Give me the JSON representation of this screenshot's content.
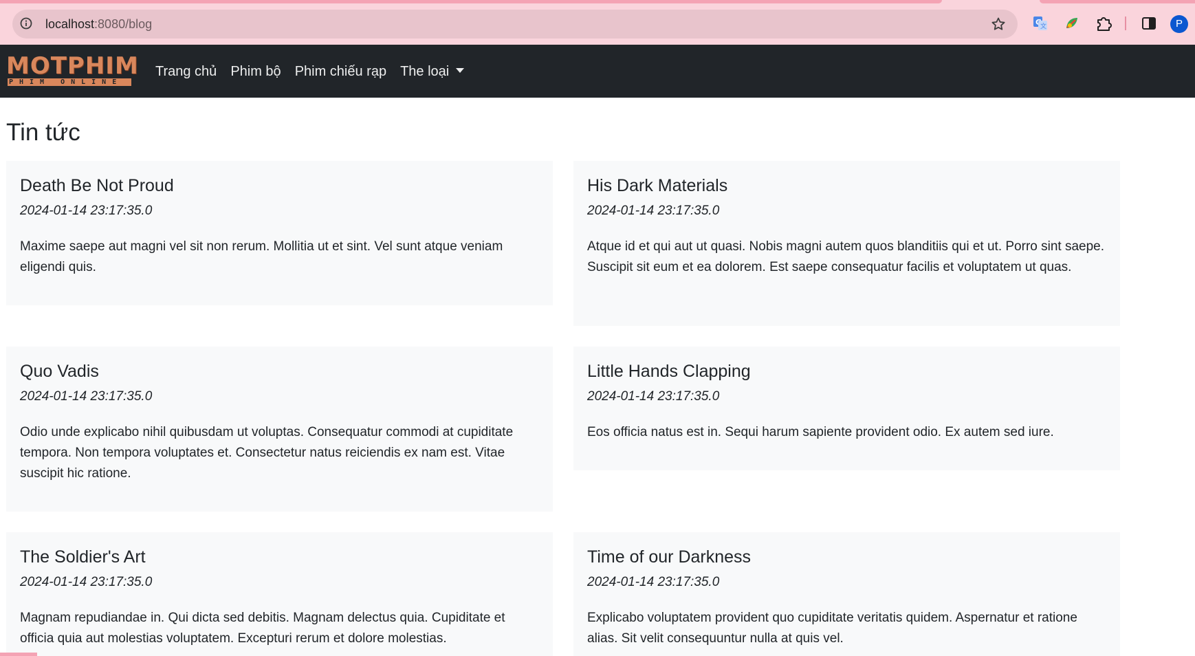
{
  "browser": {
    "url_host": "localhost",
    "url_rest": ":8080/blog",
    "profile_initial": "P",
    "icons": [
      "info-icon",
      "star-icon",
      "translate-icon",
      "extension-leaf-icon",
      "puzzle-icon",
      "sidepanel-icon"
    ]
  },
  "navbar": {
    "brand": "MOTPHIM",
    "brand_sub": "PHIM ONLINE",
    "links": [
      "Trang chủ",
      "Phim bộ",
      "Phim chiếu rạp",
      "The loại"
    ]
  },
  "page": {
    "title": "Tin tức"
  },
  "posts": [
    {
      "title": "Death Be Not Proud",
      "date": "2024-01-14 23:17:35.0",
      "body": "Maxime saepe aut magni vel sit non rerum. Mollitia ut et sint. Vel sunt atque veniam eligendi quis."
    },
    {
      "title": "His Dark Materials",
      "date": "2024-01-14 23:17:35.0",
      "body": "Atque id et qui aut ut quasi. Nobis magni autem quos blanditiis qui et ut. Porro sint saepe. Suscipit sit eum et ea dolorem. Est saepe consequatur facilis et voluptatem ut quas."
    },
    {
      "title": "Quo Vadis",
      "date": "2024-01-14 23:17:35.0",
      "body": "Odio unde explicabo nihil quibusdam ut voluptas. Consequatur commodi at cupiditate tempora. Non tempora voluptates et. Consectetur natus reiciendis ex nam est. Vitae suscipit hic ratione."
    },
    {
      "title": "Little Hands Clapping",
      "date": "2024-01-14 23:17:35.0",
      "body": "Eos officia natus est in. Sequi harum sapiente provident odio. Ex autem sed iure."
    },
    {
      "title": "The Soldier's Art",
      "date": "2024-01-14 23:17:35.0",
      "body": "Magnam repudiandae in. Qui dicta sed debitis. Magnam delectus quia. Cupiditate et officia quia aut molestias voluptatem. Excepturi rerum et dolore molestias."
    },
    {
      "title": "Time of our Darkness",
      "date": "2024-01-14 23:17:35.0",
      "body": "Explicabo voluptatem provident quo cupiditate veritatis quidem. Aspernatur et ratione alias. Sit velit consequuntur nulla at quis vel."
    }
  ],
  "colors": {
    "chrome_bg": "#fad4dc",
    "navbar_bg": "#212529",
    "card_bg": "#f8f9fa",
    "brand": "#d9875c"
  }
}
